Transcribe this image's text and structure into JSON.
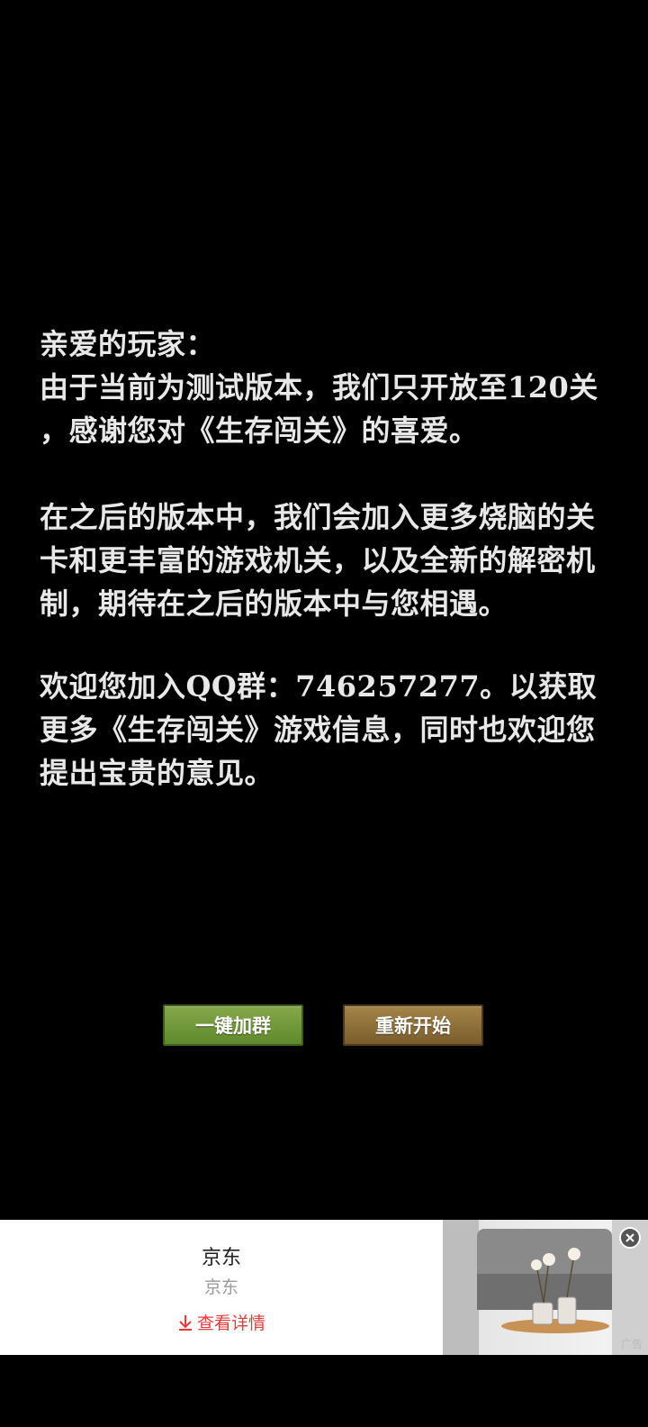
{
  "notice": {
    "paragraph1": "亲爱的玩家：\n由于当前为测试版本，我们只开放至120关\n，感谢您对《生存闯关》的喜爱。",
    "paragraph2": "在之后的版本中，我们会加入更多烧脑的关卡和更丰富的游戏机关，以及全新的解密机制，期待在之后的版本中与您相遇。",
    "paragraph3": "欢迎您加入QQ群：746257277。以获取更多《生存闯关》游戏信息，同时也欢迎您提出宝贵的意见。"
  },
  "buttons": {
    "join_group": "一键加群",
    "restart": "重新开始"
  },
  "ad": {
    "title": "京东",
    "subtitle": "京东",
    "link": "查看详情",
    "badge": "广告",
    "link_icon": "download-arrow-icon",
    "close_icon": "close-icon"
  },
  "colors": {
    "text": "#e8e8e8",
    "green_button": "#6f9638",
    "brown_button": "#8c6e3a",
    "ad_link": "#e83a3a"
  }
}
